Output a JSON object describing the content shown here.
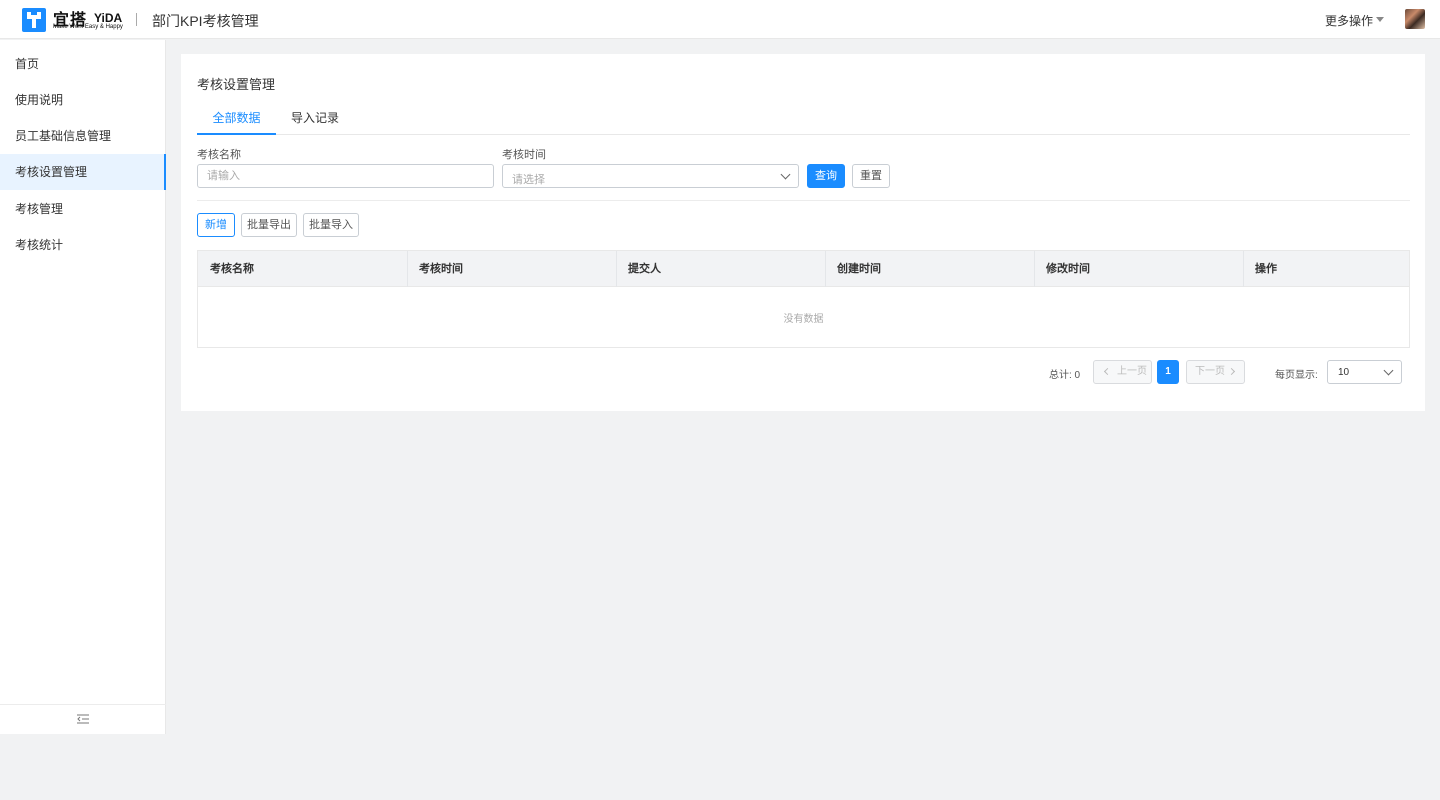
{
  "header": {
    "logo_cn": "宜搭",
    "logo_en": "YiDA",
    "logo_slogan": "Make Work Easy & Happy",
    "app_title": "部门KPI考核管理",
    "more_ops": "更多操作"
  },
  "sidebar": {
    "items": [
      {
        "label": "首页"
      },
      {
        "label": "使用说明"
      },
      {
        "label": "员工基础信息管理"
      },
      {
        "label": "考核设置管理",
        "active": true
      },
      {
        "label": "考核管理"
      },
      {
        "label": "考核统计"
      }
    ]
  },
  "main": {
    "page_title": "考核设置管理",
    "tabs": [
      {
        "label": "全部数据",
        "active": true
      },
      {
        "label": "导入记录"
      }
    ],
    "filters": {
      "name_label": "考核名称",
      "name_placeholder": "请输入",
      "time_label": "考核时间",
      "time_placeholder": "请选择",
      "query_button": "查询",
      "reset_button": "重置"
    },
    "actions": {
      "add": "新增",
      "export": "批量导出",
      "import": "批量导入"
    },
    "table": {
      "columns": [
        "考核名称",
        "考核时间",
        "提交人",
        "创建时间",
        "修改时间",
        "操作"
      ],
      "rows": [],
      "empty_text": "没有数据"
    },
    "pagination": {
      "total_text": "总计: 0",
      "prev": "上一页",
      "next": "下一页",
      "current_page": "1",
      "per_page_label": "每页显示:",
      "per_page_value": "10"
    }
  },
  "colors": {
    "accent": "#1a8cff",
    "background": "#f1f2f3",
    "active_nav_bg": "#e8f3ff"
  }
}
